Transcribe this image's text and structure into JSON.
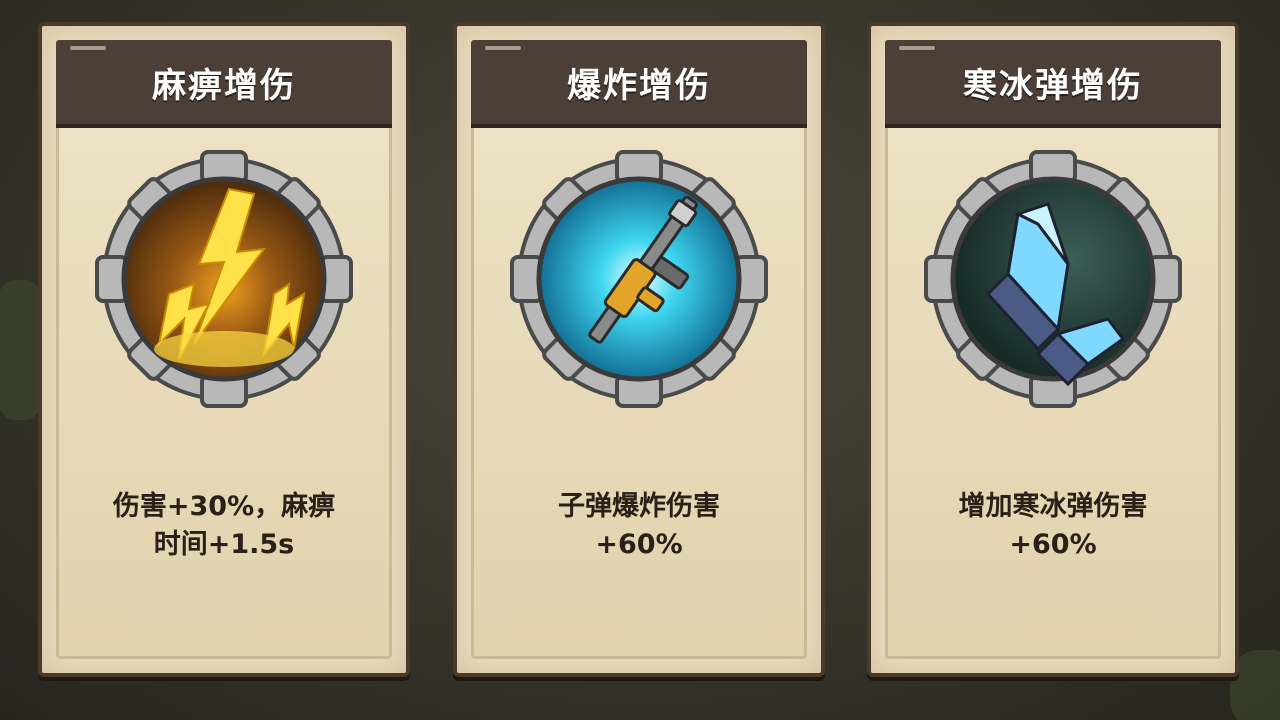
{
  "cards": [
    {
      "title": "麻痹增伤",
      "icon": "lightning-icon",
      "desc_line1": "伤害+30%，麻痹",
      "desc_line2": "时间+1.5s"
    },
    {
      "title": "爆炸增伤",
      "icon": "rifle-icon",
      "desc_line1": "子弹爆炸伤害",
      "desc_line2": "+60%"
    },
    {
      "title": "寒冰弹增伤",
      "icon": "ice-bullet-icon",
      "desc_line1": "增加寒冰弹伤害",
      "desc_line2": "+60%"
    }
  ],
  "colors": {
    "card_bg": "#e9dcbd",
    "title_bar": "#4b3f38",
    "text": "#2a2018",
    "gear": "#b7b7b7"
  }
}
